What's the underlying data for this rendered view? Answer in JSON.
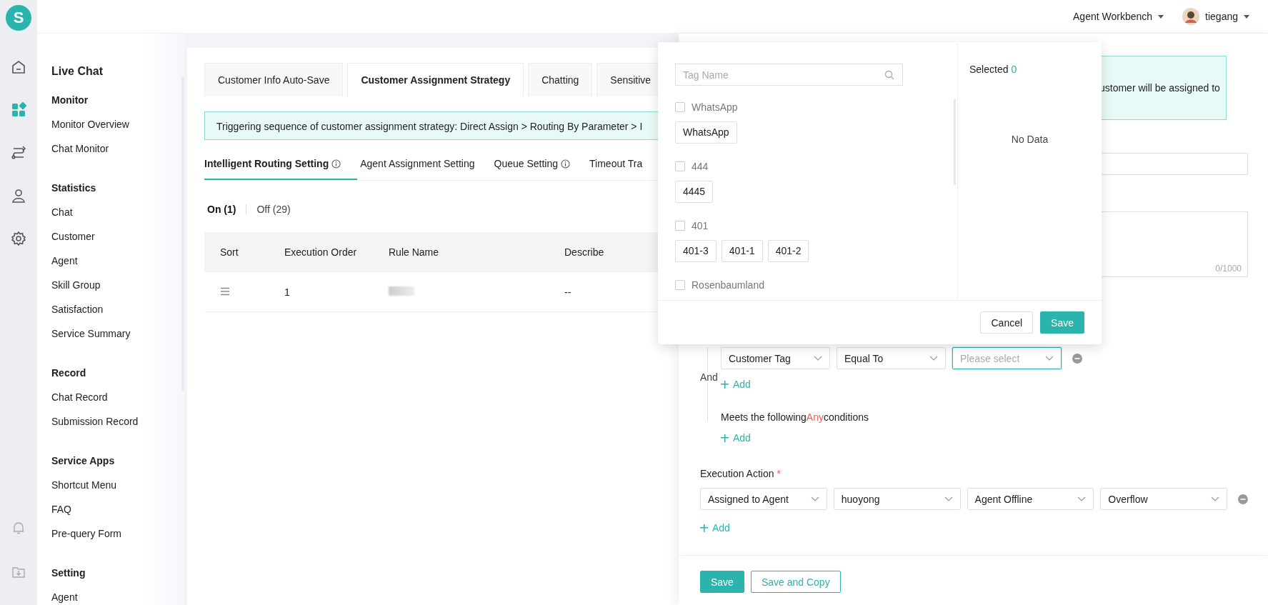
{
  "rail": [
    {
      "kind": "home",
      "selected": false
    },
    {
      "kind": "apps",
      "selected": true
    },
    {
      "kind": "flow",
      "selected": false
    },
    {
      "kind": "person",
      "selected": false
    },
    {
      "kind": "settings",
      "selected": false
    }
  ],
  "rail_bottom": [
    {
      "kind": "bell"
    },
    {
      "kind": "download"
    }
  ],
  "logo": "S",
  "top_bar": {
    "workbench": "Agent Workbench",
    "user": "tiegang"
  },
  "sidebar": {
    "title": "Live Chat",
    "groups": [
      {
        "heading": "Monitor",
        "items": [
          "Monitor Overview",
          "Chat Monitor"
        ]
      },
      {
        "heading": "Statistics",
        "items": [
          "Chat",
          "Customer",
          "Agent",
          "Skill Group",
          "Satisfaction",
          "Service Summary"
        ]
      },
      {
        "heading": "Record",
        "items": [
          "Chat Record",
          "Submission Record"
        ]
      },
      {
        "heading": "Service Apps",
        "items": [
          "Shortcut Menu",
          "FAQ",
          "Pre-query Form"
        ]
      },
      {
        "heading": "Setting",
        "items": [
          "Agent"
        ]
      }
    ]
  },
  "main": {
    "tabs": [
      {
        "label": "Customer Info Auto-Save",
        "selected": false
      },
      {
        "label": "Customer Assignment Strategy",
        "selected": true
      },
      {
        "label": "Chatting",
        "selected": false
      },
      {
        "label": "Sensitive",
        "selected": false
      }
    ],
    "notice": "Triggering sequence of customer assignment strategy: Direct Assign > Routing By Parameter > I",
    "sub_tabs": [
      {
        "label": "Intelligent Routing Setting",
        "info": true,
        "selected": true
      },
      {
        "label": "Agent Assignment Setting",
        "info": false,
        "selected": false
      },
      {
        "label": "Queue Setting",
        "info": true,
        "selected": false
      },
      {
        "label": "Timeout Tra",
        "info": false,
        "selected": false
      }
    ],
    "filters": [
      {
        "label": "On (1)",
        "selected": true
      },
      {
        "label": "Off (29)",
        "selected": false
      }
    ],
    "table": {
      "columns": [
        "Sort",
        "Execution Order",
        "Rule Name",
        "Describe"
      ],
      "rows": [
        {
          "execution_order": "1",
          "rule_name": {
            "kind": "redacted"
          },
          "describe": "--"
        }
      ]
    }
  },
  "drawer": {
    "notice": "ustomer will be assigned to",
    "counter": "0/1000",
    "conditions": {
      "join": "And",
      "rows": [
        {
          "field": "Customer Tag",
          "operator": "Equal To",
          "placeholder": "Please select",
          "focused": true
        }
      ],
      "add": "Add",
      "any_prefix": "Meets the following",
      "any_word": "Any",
      "any_suffix": "conditions",
      "any_add": "Add"
    },
    "action_label": "Execution Action",
    "required_mark": "*",
    "actions": [
      [
        "Assigned to Agent",
        "huoyong",
        "Agent Offline",
        "Overflow"
      ]
    ],
    "action_add": "Add",
    "save": "Save",
    "save_copy": "Save and Copy"
  },
  "popover": {
    "search_placeholder": "Tag Name",
    "groups": [
      {
        "name": "WhatsApp",
        "checked": false,
        "tags": [
          {
            "label": "WhatsApp",
            "selected": false
          }
        ]
      },
      {
        "name": "444",
        "checked": false,
        "tags": [
          {
            "label": "4445",
            "selected": false
          }
        ]
      },
      {
        "name": "401",
        "checked": false,
        "tags": [
          {
            "label": "401-3",
            "selected": false
          },
          {
            "label": "401-1",
            "selected": false
          },
          {
            "label": "401-2",
            "selected": false
          }
        ]
      },
      {
        "name": "Rosenbaumland",
        "checked": false
      }
    ],
    "selected_label": "Selected",
    "selected_count": "0",
    "empty": "No Data",
    "cancel": "Cancel",
    "save": "Save"
  }
}
